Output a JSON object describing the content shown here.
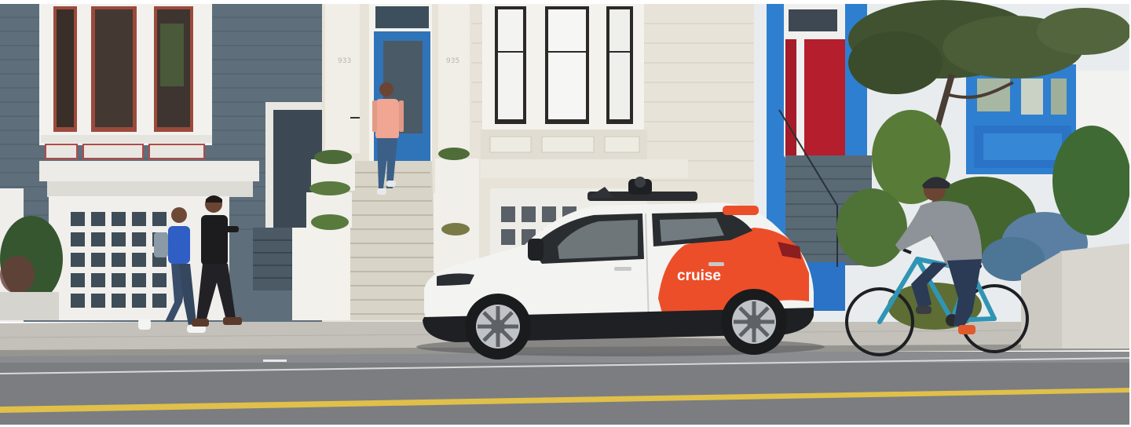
{
  "photo": {
    "vehicle_branding": "cruise",
    "house_numbers": [
      "933",
      "935"
    ]
  },
  "colors": {
    "brand_orange": "#ec4e2a",
    "car_white": "#f3f3f1",
    "house_grey_blue": "#5e6f7b",
    "house_cream": "#e7e3d8",
    "house_blue": "#2f7fd0",
    "door_red": "#b51e2c",
    "door_blue": "#2f74b8",
    "road_asphalt": "#7b7d80",
    "road_center_line": "#e8c848"
  }
}
